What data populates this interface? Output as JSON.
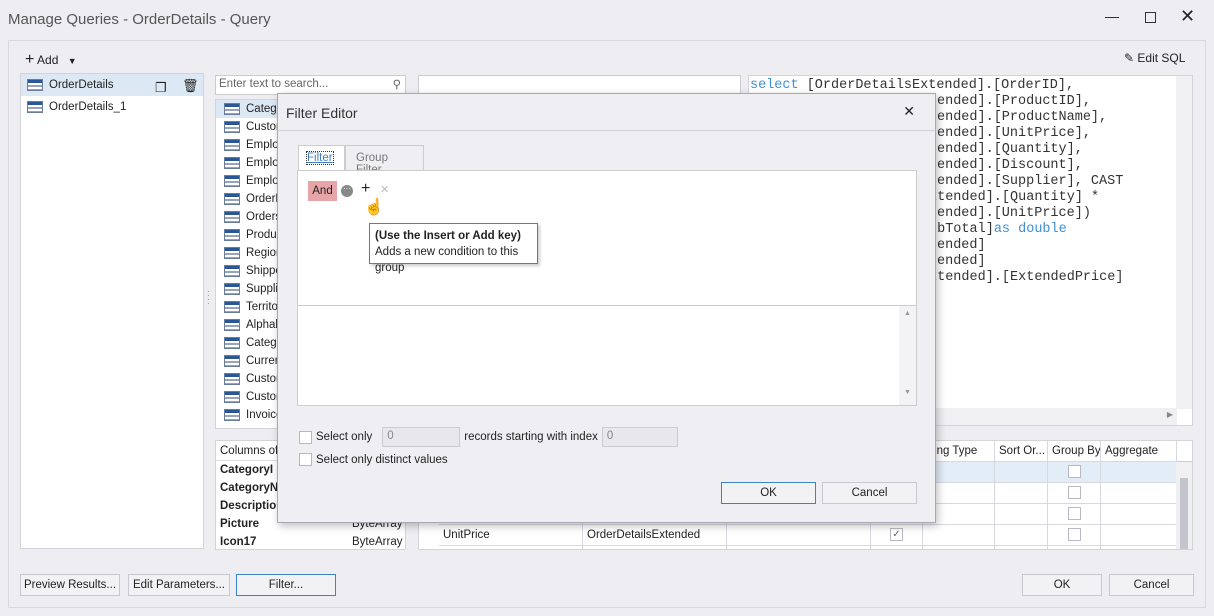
{
  "window": {
    "title": "Manage Queries - OrderDetails - Query"
  },
  "toolbar": {
    "add_label": "Add",
    "edit_sql_label": "Edit SQL"
  },
  "queries": [
    {
      "label": "OrderDetails",
      "selected": true
    },
    {
      "label": "OrderDetails_1",
      "selected": false
    }
  ],
  "tables": {
    "search_placeholder": "Enter text to search...",
    "items": [
      "Catego",
      "Custom",
      "Employ",
      "Employ",
      "Employ",
      "OrderD",
      "Orders",
      "Produc",
      "Region",
      "Shippe",
      "Supplie",
      "Territo",
      "Alphab",
      "Catego",
      "Curren",
      "Custom",
      "Custom",
      "Invoice"
    ]
  },
  "columns_panel": {
    "header": "Columns of C",
    "rows": [
      {
        "name": "CategoryI",
        "type": ""
      },
      {
        "name": "CategoryN",
        "type": ""
      },
      {
        "name": "Descriptio",
        "type": ""
      },
      {
        "name": "Picture",
        "type": "ByteArray"
      },
      {
        "name": "Icon17",
        "type": "ByteArray"
      }
    ]
  },
  "sql": {
    "keyword": "select",
    "first_line_rest": " [OrderDetailsExtended].[OrderID],",
    "lines": [
      "ended].[ProductID],",
      "ended].[ProductName],",
      "ended].[UnitPrice],",
      "ended].[Quantity],",
      "ended].[Discount],",
      "ended].[Supplier], CAST",
      "xtended].[Quantity] *",
      "ended].[UnitPrice]) ",
      "ubTotal]",
      "ended]",
      "ended]",
      "xtended].[ExtendedPrice]"
    ],
    "as_double": "as double"
  },
  "grid": {
    "headers": [
      "rting Type",
      "Sort Or...",
      "Group By",
      "Aggregate"
    ],
    "row": {
      "column": "UnitPrice",
      "table": "OrderDetailsExtended",
      "output": true
    }
  },
  "footer": {
    "preview": "Preview Results...",
    "edit_params": "Edit Parameters...",
    "filter": "Filter...",
    "ok": "OK",
    "cancel": "Cancel"
  },
  "dialog": {
    "title": "Filter Editor",
    "tabs": [
      "Filter",
      "Group Filter"
    ],
    "group_operator": "And",
    "tooltip_title": "(Use the Insert or Add key)",
    "tooltip_text": "Adds a new condition to this group",
    "select_only": "Select only",
    "select_only_value": "0",
    "records_from": "records starting with index",
    "records_from_value": "0",
    "distinct": "Select only distinct values",
    "ok": "OK",
    "cancel": "Cancel",
    "and_color": "#e8a5a8"
  }
}
